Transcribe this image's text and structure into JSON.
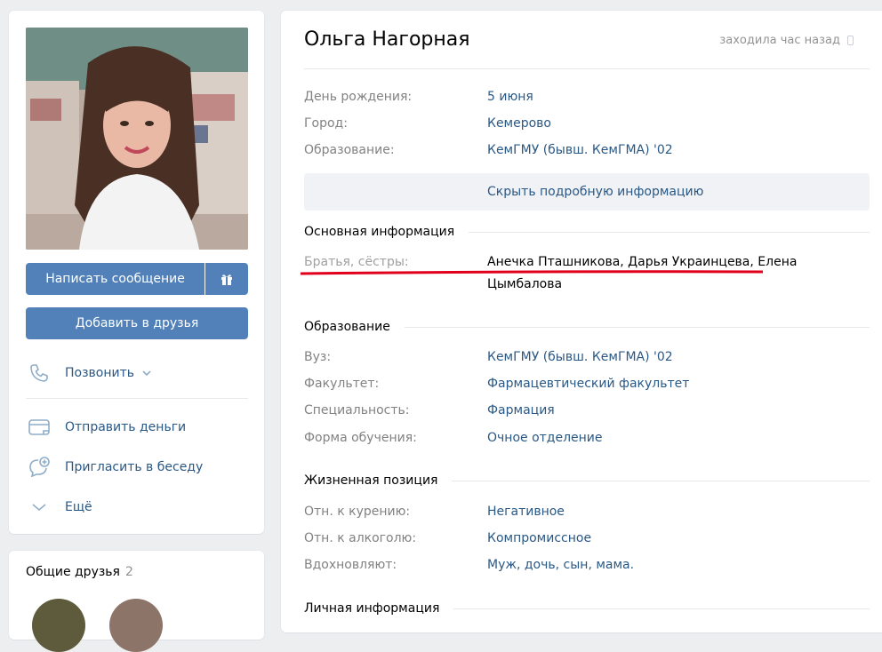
{
  "left": {
    "message_button": "Написать сообщение",
    "add_friend_button": "Добавить в друзья",
    "call_label": "Позвонить",
    "send_money_label": "Отправить деньги",
    "invite_label": "Пригласить в беседу",
    "more_label": "Ещё"
  },
  "friends": {
    "title": "Общие друзья",
    "count": "2"
  },
  "profile": {
    "name": "Ольга Нагорная",
    "last_seen": "заходила час назад",
    "short_info": [
      {
        "label": "День рождения:",
        "value": "5 июня"
      },
      {
        "label": "Город:",
        "value": "Кемерово"
      },
      {
        "label": "Образование:",
        "value": "КемГМУ (бывш. КемГМА) '02"
      }
    ],
    "toggle_label": "Скрыть подробную информацию",
    "basic": {
      "title": "Основная информация",
      "siblings_label": "Братья, сёстры:",
      "siblings_value": "Анечка Пташникова, Дарья Украинцева, Елена Цымбалова"
    },
    "education": {
      "title": "Образование",
      "rows": [
        {
          "label": "Вуз:",
          "value": "КемГМУ (бывш. КемГМА) '02"
        },
        {
          "label": "Факультет:",
          "value": "Фармацевтический факультет"
        },
        {
          "label": "Специальность:",
          "value": "Фармация"
        },
        {
          "label": "Форма обучения:",
          "value": "Очное отделение"
        }
      ]
    },
    "life": {
      "title": "Жизненная позиция",
      "rows": [
        {
          "label": "Отн. к курению:",
          "value": "Негативное"
        },
        {
          "label": "Отн. к алкоголю:",
          "value": "Компромиссное"
        },
        {
          "label": "Вдохновляют:",
          "value": "Муж, дочь, сын, мама."
        }
      ]
    },
    "personal_title": "Личная информация"
  },
  "colors": {
    "accent": "#5181b8",
    "link": "#2a5885",
    "annotation": "#e0001b"
  }
}
